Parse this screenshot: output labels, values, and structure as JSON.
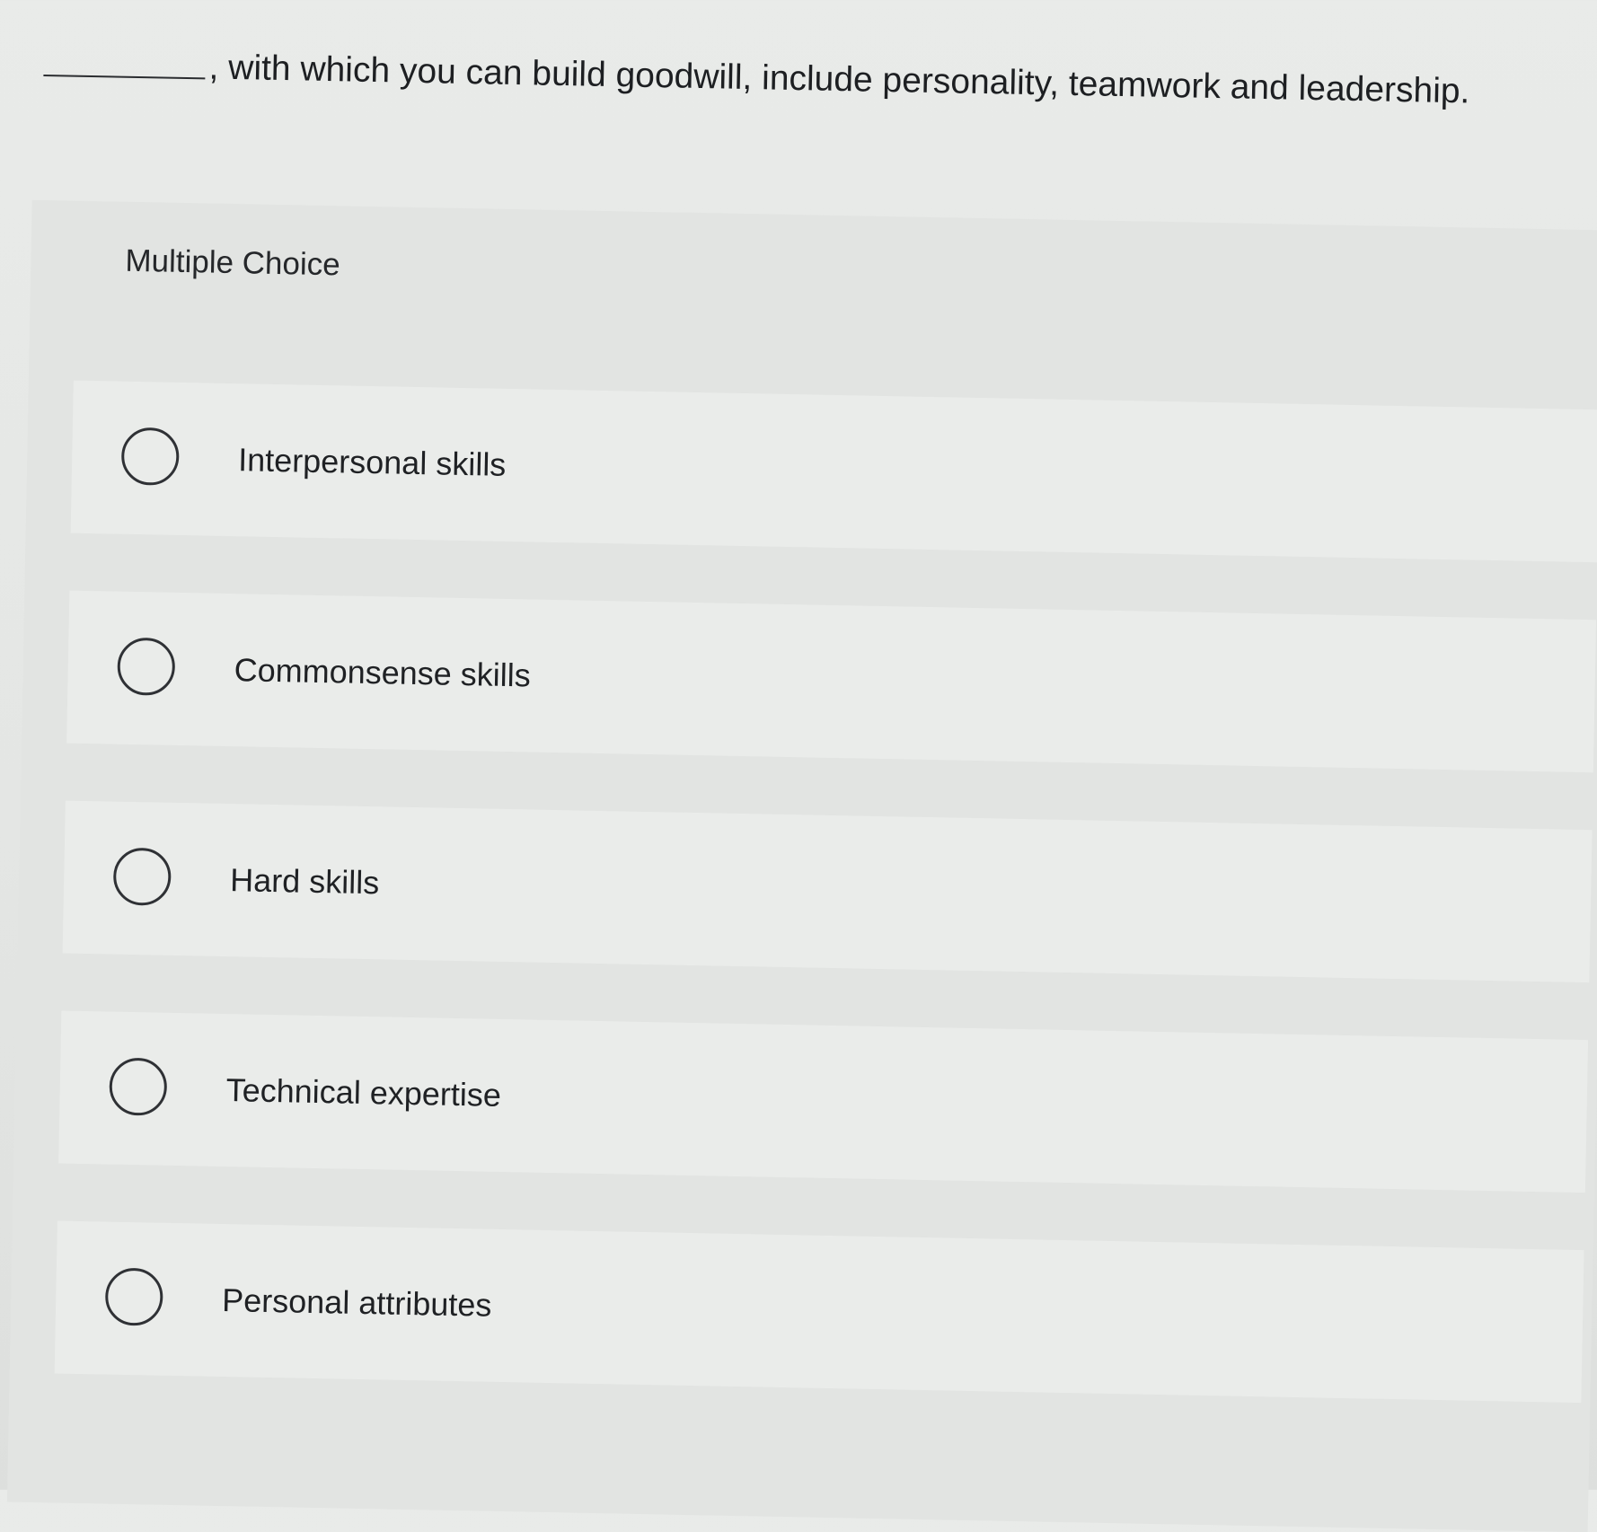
{
  "question": {
    "stem": ", with which you can build goodwill, include personality, teamwork and leadership."
  },
  "section": {
    "label": "Multiple Choice"
  },
  "options": [
    {
      "label": "Interpersonal skills",
      "selected": false
    },
    {
      "label": "Commonsense skills",
      "selected": false
    },
    {
      "label": "Hard skills",
      "selected": false
    },
    {
      "label": "Technical expertise",
      "selected": false
    },
    {
      "label": "Personal attributes",
      "selected": false
    }
  ]
}
